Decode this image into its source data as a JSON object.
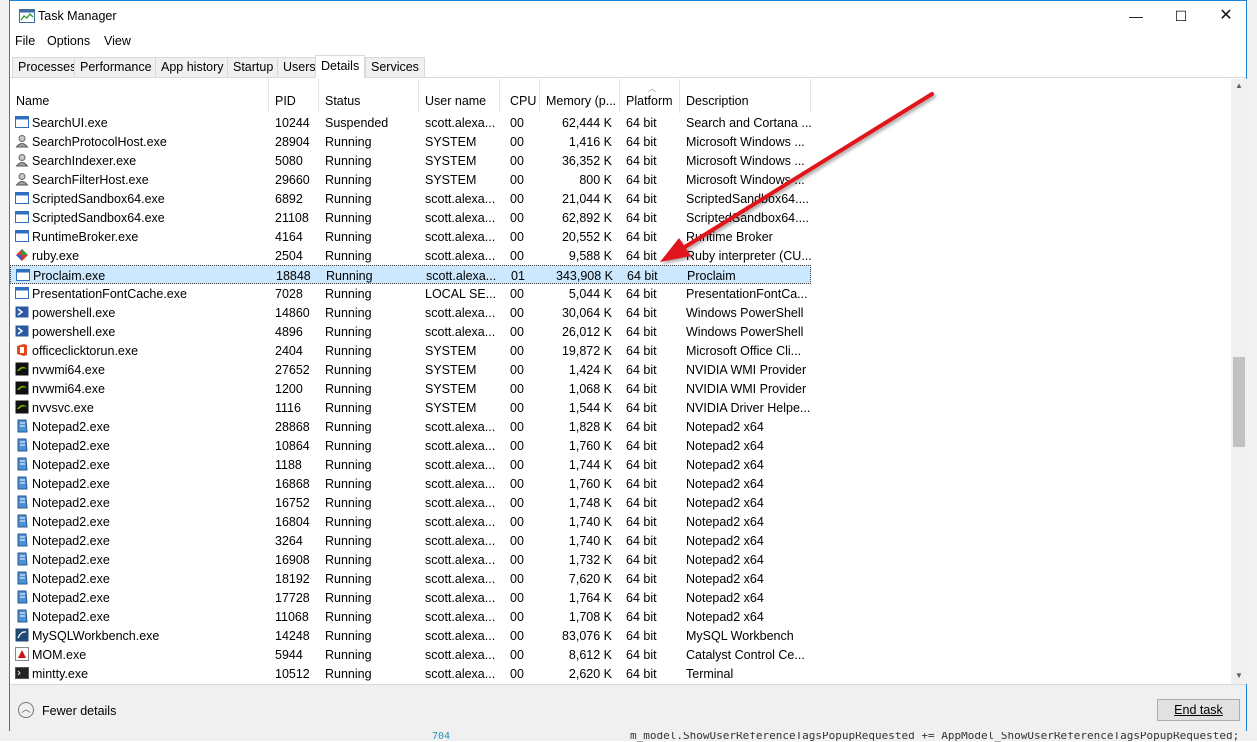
{
  "window": {
    "title": "Task Manager",
    "minimize": "—",
    "maximize": "☐",
    "close": "✕"
  },
  "menu": [
    "File",
    "Options",
    "View"
  ],
  "tabs": [
    "Processes",
    "Performance",
    "App history",
    "Startup",
    "Users",
    "Details",
    "Services"
  ],
  "active_tab": "Details",
  "columns": [
    "Name",
    "PID",
    "Status",
    "User name",
    "CPU",
    "Memory (p...",
    "Platform",
    "Description"
  ],
  "rows": [
    {
      "icon": "window-app-icon",
      "name": "SearchUI.exe",
      "pid": "10244",
      "status": "Suspended",
      "user": "scott.alexa...",
      "cpu": "00",
      "mem": "62,444 K",
      "platform": "64 bit",
      "desc": "Search and Cortana ..."
    },
    {
      "icon": "user-service-icon",
      "name": "SearchProtocolHost.exe",
      "pid": "28904",
      "status": "Running",
      "user": "SYSTEM",
      "cpu": "00",
      "mem": "1,416 K",
      "platform": "64 bit",
      "desc": "Microsoft Windows ..."
    },
    {
      "icon": "user-service-icon",
      "name": "SearchIndexer.exe",
      "pid": "5080",
      "status": "Running",
      "user": "SYSTEM",
      "cpu": "00",
      "mem": "36,352 K",
      "platform": "64 bit",
      "desc": "Microsoft Windows ..."
    },
    {
      "icon": "user-service-icon",
      "name": "SearchFilterHost.exe",
      "pid": "29660",
      "status": "Running",
      "user": "SYSTEM",
      "cpu": "00",
      "mem": "800 K",
      "platform": "64 bit",
      "desc": "Microsoft Windows ..."
    },
    {
      "icon": "window-app-icon",
      "name": "ScriptedSandbox64.exe",
      "pid": "6892",
      "status": "Running",
      "user": "scott.alexa...",
      "cpu": "00",
      "mem": "21,044 K",
      "platform": "64 bit",
      "desc": "ScriptedSandbox64...."
    },
    {
      "icon": "window-app-icon",
      "name": "ScriptedSandbox64.exe",
      "pid": "21108",
      "status": "Running",
      "user": "scott.alexa...",
      "cpu": "00",
      "mem": "62,892 K",
      "platform": "64 bit",
      "desc": "ScriptedSandbox64...."
    },
    {
      "icon": "window-app-icon",
      "name": "RuntimeBroker.exe",
      "pid": "4164",
      "status": "Running",
      "user": "scott.alexa...",
      "cpu": "00",
      "mem": "20,552 K",
      "platform": "64 bit",
      "desc": "Runtime Broker"
    },
    {
      "icon": "ruby-icon",
      "name": "ruby.exe",
      "pid": "2504",
      "status": "Running",
      "user": "scott.alexa...",
      "cpu": "00",
      "mem": "9,588 K",
      "platform": "64 bit",
      "desc": "Ruby interpreter (CU..."
    },
    {
      "icon": "window-app-icon",
      "name": "Proclaim.exe",
      "pid": "18848",
      "status": "Running",
      "user": "scott.alexa...",
      "cpu": "01",
      "mem": "343,908 K",
      "platform": "64 bit",
      "desc": "Proclaim",
      "selected": true
    },
    {
      "icon": "window-app-icon",
      "name": "PresentationFontCache.exe",
      "pid": "7028",
      "status": "Running",
      "user": "LOCAL SE...",
      "cpu": "00",
      "mem": "5,044 K",
      "platform": "64 bit",
      "desc": "PresentationFontCa..."
    },
    {
      "icon": "powershell-icon",
      "name": "powershell.exe",
      "pid": "14860",
      "status": "Running",
      "user": "scott.alexa...",
      "cpu": "00",
      "mem": "30,064 K",
      "platform": "64 bit",
      "desc": "Windows PowerShell"
    },
    {
      "icon": "powershell-icon",
      "name": "powershell.exe",
      "pid": "4896",
      "status": "Running",
      "user": "scott.alexa...",
      "cpu": "00",
      "mem": "26,012 K",
      "platform": "64 bit",
      "desc": "Windows PowerShell"
    },
    {
      "icon": "office-icon",
      "name": "officeclicktorun.exe",
      "pid": "2404",
      "status": "Running",
      "user": "SYSTEM",
      "cpu": "00",
      "mem": "19,872 K",
      "platform": "64 bit",
      "desc": "Microsoft Office Cli..."
    },
    {
      "icon": "nvidia-icon",
      "name": "nvwmi64.exe",
      "pid": "27652",
      "status": "Running",
      "user": "SYSTEM",
      "cpu": "00",
      "mem": "1,424 K",
      "platform": "64 bit",
      "desc": "NVIDIA WMI Provider"
    },
    {
      "icon": "nvidia-icon",
      "name": "nvwmi64.exe",
      "pid": "1200",
      "status": "Running",
      "user": "SYSTEM",
      "cpu": "00",
      "mem": "1,068 K",
      "platform": "64 bit",
      "desc": "NVIDIA WMI Provider"
    },
    {
      "icon": "nvidia-icon",
      "name": "nvvsvc.exe",
      "pid": "1116",
      "status": "Running",
      "user": "SYSTEM",
      "cpu": "00",
      "mem": "1,544 K",
      "platform": "64 bit",
      "desc": "NVIDIA Driver Helpe..."
    },
    {
      "icon": "notepad2-icon",
      "name": "Notepad2.exe",
      "pid": "28868",
      "status": "Running",
      "user": "scott.alexa...",
      "cpu": "00",
      "mem": "1,828 K",
      "platform": "64 bit",
      "desc": "Notepad2 x64"
    },
    {
      "icon": "notepad2-icon",
      "name": "Notepad2.exe",
      "pid": "10864",
      "status": "Running",
      "user": "scott.alexa...",
      "cpu": "00",
      "mem": "1,760 K",
      "platform": "64 bit",
      "desc": "Notepad2 x64"
    },
    {
      "icon": "notepad2-icon",
      "name": "Notepad2.exe",
      "pid": "1188",
      "status": "Running",
      "user": "scott.alexa...",
      "cpu": "00",
      "mem": "1,744 K",
      "platform": "64 bit",
      "desc": "Notepad2 x64"
    },
    {
      "icon": "notepad2-icon",
      "name": "Notepad2.exe",
      "pid": "16868",
      "status": "Running",
      "user": "scott.alexa...",
      "cpu": "00",
      "mem": "1,760 K",
      "platform": "64 bit",
      "desc": "Notepad2 x64"
    },
    {
      "icon": "notepad2-icon",
      "name": "Notepad2.exe",
      "pid": "16752",
      "status": "Running",
      "user": "scott.alexa...",
      "cpu": "00",
      "mem": "1,748 K",
      "platform": "64 bit",
      "desc": "Notepad2 x64"
    },
    {
      "icon": "notepad2-icon",
      "name": "Notepad2.exe",
      "pid": "16804",
      "status": "Running",
      "user": "scott.alexa...",
      "cpu": "00",
      "mem": "1,740 K",
      "platform": "64 bit",
      "desc": "Notepad2 x64"
    },
    {
      "icon": "notepad2-icon",
      "name": "Notepad2.exe",
      "pid": "3264",
      "status": "Running",
      "user": "scott.alexa...",
      "cpu": "00",
      "mem": "1,740 K",
      "platform": "64 bit",
      "desc": "Notepad2 x64"
    },
    {
      "icon": "notepad2-icon",
      "name": "Notepad2.exe",
      "pid": "16908",
      "status": "Running",
      "user": "scott.alexa...",
      "cpu": "00",
      "mem": "1,732 K",
      "platform": "64 bit",
      "desc": "Notepad2 x64"
    },
    {
      "icon": "notepad2-icon",
      "name": "Notepad2.exe",
      "pid": "18192",
      "status": "Running",
      "user": "scott.alexa...",
      "cpu": "00",
      "mem": "7,620 K",
      "platform": "64 bit",
      "desc": "Notepad2 x64"
    },
    {
      "icon": "notepad2-icon",
      "name": "Notepad2.exe",
      "pid": "17728",
      "status": "Running",
      "user": "scott.alexa...",
      "cpu": "00",
      "mem": "1,764 K",
      "platform": "64 bit",
      "desc": "Notepad2 x64"
    },
    {
      "icon": "notepad2-icon",
      "name": "Notepad2.exe",
      "pid": "11068",
      "status": "Running",
      "user": "scott.alexa...",
      "cpu": "00",
      "mem": "1,708 K",
      "platform": "64 bit",
      "desc": "Notepad2 x64"
    },
    {
      "icon": "mysql-icon",
      "name": "MySQLWorkbench.exe",
      "pid": "14248",
      "status": "Running",
      "user": "scott.alexa...",
      "cpu": "00",
      "mem": "83,076 K",
      "platform": "64 bit",
      "desc": "MySQL Workbench"
    },
    {
      "icon": "catalyst-icon",
      "name": "MOM.exe",
      "pid": "5944",
      "status": "Running",
      "user": "scott.alexa...",
      "cpu": "00",
      "mem": "8,612 K",
      "platform": "64 bit",
      "desc": "Catalyst Control Ce..."
    },
    {
      "icon": "terminal-icon",
      "name": "mintty.exe",
      "pid": "10512",
      "status": "Running",
      "user": "scott.alexa...",
      "cpu": "00",
      "mem": "2,620 K",
      "platform": "64 bit",
      "desc": "Terminal"
    }
  ],
  "footer": {
    "fewer_details": "Fewer details",
    "end_task": "End task"
  },
  "background": {
    "code_line": "m_model.ShowUserReferenceTagsPopupRequested += AppModel_ShowUserReferenceTagsPopupRequested;",
    "line_number": "704"
  },
  "colors": {
    "selection": "#cce8ff",
    "arrow": "#e0191b",
    "border": "#1883d7"
  }
}
